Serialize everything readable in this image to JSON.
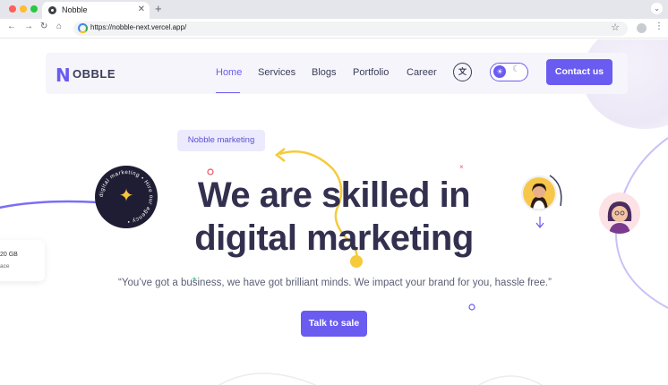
{
  "browser": {
    "tab_title": "Nobble",
    "url": "https://nobble-next.vercel.app/"
  },
  "nav": {
    "logo_mark": "N",
    "logo_text": "OBBLE",
    "items": [
      "Home",
      "Services",
      "Blogs",
      "Portfolio",
      "Career"
    ],
    "active": "Home",
    "translate_icon": "文",
    "contact_label": "Contact us"
  },
  "hero": {
    "pill": "Nobble marketing",
    "badge_text": "digital marketing • Hire our agency •",
    "headline_line1": "We are skilled in",
    "headline_line2": "digital marketing",
    "subtext": "“You’ve got a business, we have got brilliant minds. We impact your brand for you, hassle free.”",
    "cta": "Talk to sale"
  },
  "side_card": {
    "line1": "20 GB",
    "line2": "ace"
  },
  "colors": {
    "accent": "#6a5cf0",
    "heading": "#33304f",
    "pill_bg": "#ecebfd",
    "decor_yellow": "#f5cb3a"
  }
}
